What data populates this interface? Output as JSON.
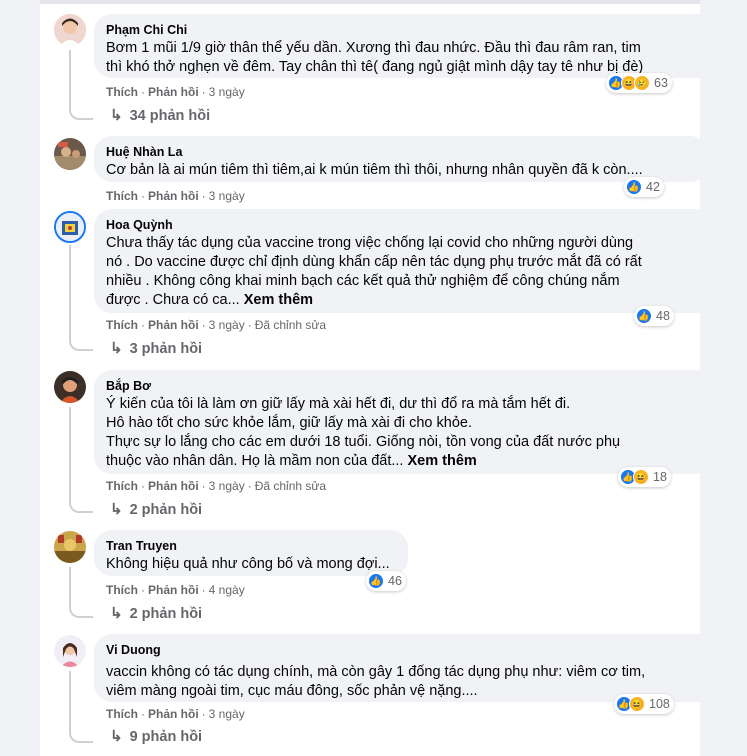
{
  "ui": {
    "like": "Thích",
    "reply": "Phản hồi",
    "dot": "·",
    "edited": "Đã chỉnh sửa",
    "see_more": "Xem thêm",
    "reply_arrow": "↳"
  },
  "comments": [
    {
      "author": "Phạm Chi Chi",
      "lines": [
        "Bơm 1 mũi 1/9 giờ thân thể yếu dần. Xương thì đau nhức. Đầu thì đau râm ran, tim",
        "thì khó thở nghẹn về đêm. Tay chân thì tê( đang ngủ giật mình dậy tay tê như bị đè)"
      ],
      "time": "3 ngày",
      "reaction_icons": [
        "like-icon",
        "haha-icon",
        "sad-icon"
      ],
      "reaction_count": "63",
      "replies": "34 phản hồi"
    },
    {
      "author": "Huệ Nhàn La",
      "lines": [
        "Cơ bản là ai mún tiêm thì tiêm,ai k mún tiêm thì thôi, nhưng nhân quyền đã k còn...."
      ],
      "time": "3 ngày",
      "reaction_icons": [
        "like-icon"
      ],
      "reaction_count": "42",
      "replies": ""
    },
    {
      "author": "Hoa Quỳnh",
      "lines": [
        "Chưa thấy tác dụng của vaccine trong việc chống lại covid cho những người dùng",
        "nó . Do vaccine được chỉ định dùng khẩn cấp nên tác dụng phụ trước mắt đã có rất",
        "nhiều . Không công khai minh bạch các kết quả thử nghiệm để công chúng nắm",
        "được . Chưa có ca..."
      ],
      "time": "3 ngày",
      "reaction_icons": [
        "like-icon"
      ],
      "reaction_count": "48",
      "replies": "3 phản hồi"
    },
    {
      "author": "Bắp Bơ",
      "lines": [
        "Ý kiến của tôi là làm ơn giữ lấy mà xài hết đi, dư thì đổ ra mà tắm hết đi.",
        "Hô hào tốt cho sức khỏe lắm, giữ lấy mà xài đi cho khỏe.",
        "Thực sự lo lắng cho các em dưới 18 tuổi. Giống nòi, tồn vong của đất nước phụ",
        "thuộc vào nhân dân. Họ là mầm non của đất..."
      ],
      "time": "3 ngày",
      "reaction_icons": [
        "like-icon",
        "haha-icon"
      ],
      "reaction_count": "18",
      "replies": "2 phản hồi"
    },
    {
      "author": "Tran Truyen",
      "lines": [
        "Không hiệu quả như công bố và mong đợi..."
      ],
      "time": "4 ngày",
      "reaction_icons": [
        "like-icon"
      ],
      "reaction_count": "46",
      "replies": "2 phản hồi"
    },
    {
      "author": "Vi Duong",
      "lines": [
        "vaccin không có tác dụng chính, mà còn gây 1 đống tác dụng phụ như: viêm cơ tim,",
        "viêm màng ngoài tim, cục máu đông, sốc phản vệ nặng...."
      ],
      "time": "3 ngày",
      "reaction_icons": [
        "like-icon",
        "haha-icon"
      ],
      "reaction_count": "108",
      "replies": "9 phản hồi"
    }
  ],
  "colors": {
    "page_bg": "#f0f2f5",
    "bubble_bg": "#f0f2f5",
    "meta_text": "#65676b",
    "body_text": "#050505",
    "like_blue": "#1877f2",
    "emoji_yellow": "#f7b125"
  }
}
